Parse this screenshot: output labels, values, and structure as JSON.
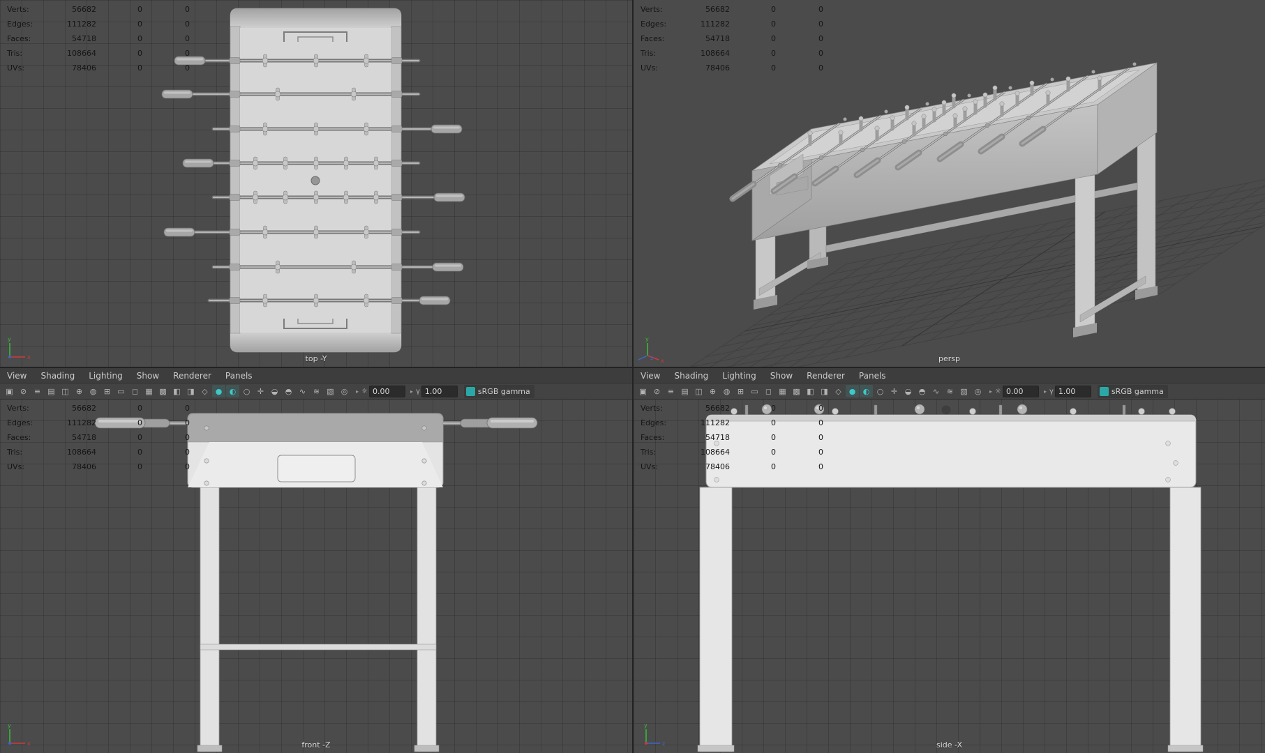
{
  "stats": {
    "rows": [
      {
        "label": "Verts:",
        "total": "56682",
        "sel": "0",
        "sel2": "0"
      },
      {
        "label": "Edges:",
        "total": "111282",
        "sel": "0",
        "sel2": "0"
      },
      {
        "label": "Faces:",
        "total": "54718",
        "sel": "0",
        "sel2": "0"
      },
      {
        "label": "Tris:",
        "total": "108664",
        "sel": "0",
        "sel2": "0"
      },
      {
        "label": "UVs:",
        "total": "78406",
        "sel": "0",
        "sel2": "0"
      }
    ]
  },
  "ui": {
    "menus": [
      "View",
      "Shading",
      "Lighting",
      "Show",
      "Renderer",
      "Panels"
    ],
    "toolbar": {
      "icons": [
        {
          "name": "select-camera-icon",
          "glyph": "▣"
        },
        {
          "name": "lock-camera-icon",
          "glyph": "⊘"
        },
        {
          "name": "camera-attributes-icon",
          "glyph": "≡"
        },
        {
          "name": "bookmark-icon",
          "glyph": "▤"
        },
        {
          "name": "image-plane-icon",
          "glyph": "◫"
        },
        {
          "name": "pan-zoom-icon",
          "glyph": "⊕"
        },
        {
          "name": "oversampling-icon",
          "glyph": "◍"
        },
        {
          "name": "grid-icon",
          "glyph": "⊞"
        },
        {
          "name": "film-gate-icon",
          "glyph": "▭"
        },
        {
          "name": "resolution-gate-icon",
          "glyph": "◻"
        },
        {
          "name": "gate-mask-icon",
          "glyph": "▦"
        },
        {
          "name": "field-chart-icon",
          "glyph": "▩"
        },
        {
          "name": "safe-action-icon",
          "glyph": "◧"
        },
        {
          "name": "safe-title-icon",
          "glyph": "◨"
        },
        {
          "name": "wireframe-icon",
          "glyph": "◇"
        },
        {
          "name": "shaded-icon",
          "glyph": "●",
          "active": true
        },
        {
          "name": "textured-icon",
          "glyph": "◐",
          "active": true
        },
        {
          "name": "default-material-icon",
          "glyph": "○"
        },
        {
          "name": "all-lights-icon",
          "glyph": "✛"
        },
        {
          "name": "shadows-icon",
          "glyph": "◒"
        },
        {
          "name": "ambient-occlusion-icon",
          "glyph": "◓"
        },
        {
          "name": "motion-blur-icon",
          "glyph": "∿"
        },
        {
          "name": "multisample-icon",
          "glyph": "≋"
        },
        {
          "name": "xray-icon",
          "glyph": "▧"
        },
        {
          "name": "isolate-select-icon",
          "glyph": "◎"
        }
      ],
      "caret": "▸",
      "exposure_icon": "☼",
      "exposure": "0.00",
      "gamma_icon": "γ",
      "gamma": "1.00",
      "colorspace": "sRGB gamma"
    }
  },
  "viewports": {
    "top": {
      "label": "top -Y"
    },
    "persp": {
      "label": "persp"
    },
    "front": {
      "label": "front -Z"
    },
    "side": {
      "label": "side -X"
    }
  },
  "axes": {
    "x": "x",
    "y": "y",
    "z": "z"
  },
  "colors": {
    "accent": "#3ec9c9",
    "viewport_bg": "#4b4b4b",
    "model_light": "#e6e6e6",
    "model_mid": "#c9c9c9"
  }
}
